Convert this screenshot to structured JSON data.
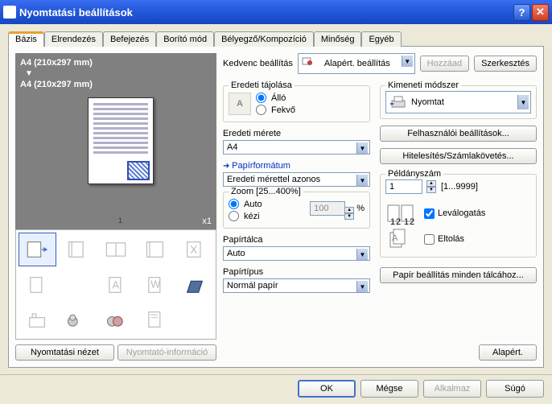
{
  "window": {
    "title": "Nyomtatási beállítások"
  },
  "tabs": [
    "Bázis",
    "Elrendezés",
    "Befejezés",
    "Borító mód",
    "Bélyegző/Kompozíció",
    "Minőség",
    "Egyéb"
  ],
  "active_tab": 0,
  "favorite": {
    "label": "Kedvenc beállítás",
    "value": "Alapért. beállítás",
    "add": "Hozzáad",
    "edit": "Szerkesztés"
  },
  "preview": {
    "from": "A4 (210x297 mm)",
    "to": "A4 (210x297 mm)",
    "multiplier": "x1",
    "page_num": "1"
  },
  "left_buttons": {
    "view": "Nyomtatási nézet",
    "info": "Nyomtató-információ"
  },
  "orientation": {
    "legend": "Eredeti tájolása",
    "portrait": "Álló",
    "landscape": "Fekvő",
    "value": "portrait"
  },
  "orig_size": {
    "label": "Eredeti mérete",
    "value": "A4"
  },
  "paper_format": {
    "label": "Papírformátum",
    "value": "Eredeti mérettel azonos"
  },
  "zoom": {
    "legend": "Zoom [25...400%]",
    "auto": "Auto",
    "manual": "kézi",
    "value": "100",
    "unit": "%",
    "mode": "auto"
  },
  "tray": {
    "label": "Papírtálca",
    "value": "Auto"
  },
  "type": {
    "label": "Papírtípus",
    "value": "Normál papír"
  },
  "output": {
    "legend": "Kimeneti módszer",
    "value": "Nyomtat"
  },
  "user_settings": "Felhasználói beállítások...",
  "auth": "Hitelesítés/Számlakövetés...",
  "copies": {
    "legend": "Példányszám",
    "value": "1",
    "range": "[1...9999]",
    "collate": "Leválogatás",
    "offset": "Eltolás",
    "collate_on": true,
    "offset_on": false
  },
  "paper_all": "Papír beállítás minden tálcához...",
  "default_btn": "Alapért.",
  "bottom": {
    "ok": "OK",
    "cancel": "Mégse",
    "apply": "Alkalmaz",
    "help": "Súgó"
  }
}
